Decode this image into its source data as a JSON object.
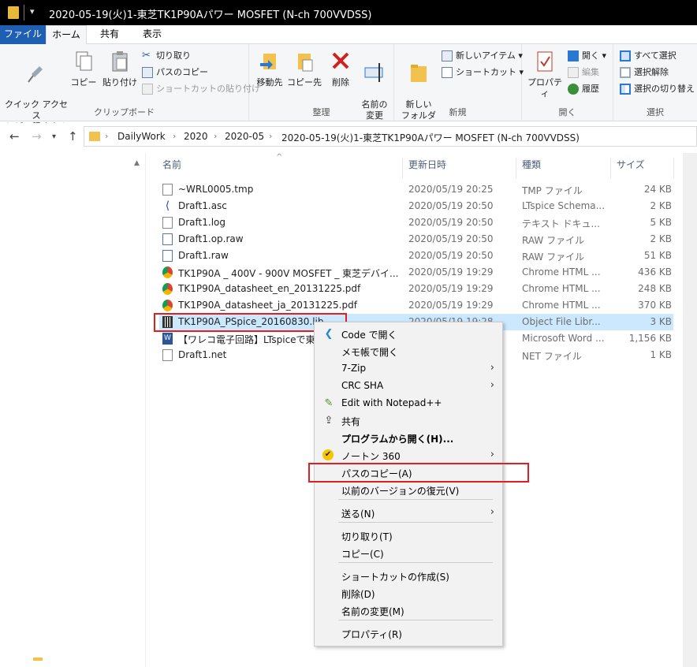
{
  "window": {
    "title": "2020-05-19(火)1-東芝TK1P90Aパワー MOSFET (N-ch 700VVDSS)"
  },
  "ribbon_tabs": [
    "ファイル",
    "ホーム",
    "共有",
    "表示"
  ],
  "ribbon": {
    "clipboard": {
      "label": "クリップボード",
      "pin": "クイック アクセス\nにピン留めする",
      "copy": "コピー",
      "paste": "貼り付け",
      "cut": "切り取り",
      "copy_path": "パスのコピー",
      "paste_shortcut": "ショートカットの貼り付け"
    },
    "organize": {
      "label": "整理",
      "move_to": "移動先",
      "copy_to": "コピー先",
      "delete": "削除",
      "rename": "名前の\n変更"
    },
    "new": {
      "label": "新規",
      "new_folder": "新しい\nフォルダー",
      "new_item": "新しいアイテム",
      "shortcut": "ショートカット"
    },
    "open": {
      "label": "開く",
      "properties": "プロパティ",
      "open": "開く",
      "edit": "編集",
      "history": "履歴"
    },
    "select": {
      "label": "選択",
      "select_all": "すべて選択",
      "select_none": "選択解除",
      "invert": "選択の切り替え"
    }
  },
  "breadcrumb": [
    "DailyWork",
    "2020",
    "2020-05",
    "2020-05-19(火)1-東芝TK1P90Aパワー MOSFET (N-ch 700VVDSS)"
  ],
  "columns": {
    "name": "名前",
    "date": "更新日時",
    "type": "種類",
    "size": "サイズ"
  },
  "files": [
    {
      "name": "~WRL0005.tmp",
      "date": "2020/05/19 20:25",
      "type": "TMP ファイル",
      "size": "24 KB",
      "icon": "blank-file-icon"
    },
    {
      "name": "Draft1.asc",
      "date": "2020/05/19 20:50",
      "type": "LTspice Schema...",
      "size": "2 KB",
      "icon": "ltspice-icon"
    },
    {
      "name": "Draft1.log",
      "date": "2020/05/19 20:50",
      "type": "テキスト ドキュ...",
      "size": "5 KB",
      "icon": "text-file-icon"
    },
    {
      "name": "Draft1.op.raw",
      "date": "2020/05/19 20:50",
      "type": "RAW ファイル",
      "size": "2 KB",
      "icon": "raw-file-icon"
    },
    {
      "name": "Draft1.raw",
      "date": "2020/05/19 20:50",
      "type": "RAW ファイル",
      "size": "51 KB",
      "icon": "raw-file-icon"
    },
    {
      "name": "TK1P90A _ 400V - 900V MOSFET _ 東芝デバイ...",
      "date": "2020/05/19 19:29",
      "type": "Chrome HTML ...",
      "size": "436 KB",
      "icon": "chrome-icon"
    },
    {
      "name": "TK1P90A_datasheet_en_20131225.pdf",
      "date": "2020/05/19 19:29",
      "type": "Chrome HTML ...",
      "size": "248 KB",
      "icon": "chrome-icon"
    },
    {
      "name": "TK1P90A_datasheet_ja_20131225.pdf",
      "date": "2020/05/19 19:29",
      "type": "Chrome HTML ...",
      "size": "370 KB",
      "icon": "chrome-icon"
    },
    {
      "name": "TK1P90A_PSpice_20160830.lib",
      "date": "2020/05/19 19:28",
      "type": "Object File Libr...",
      "size": "3 KB",
      "icon": "lib-file-icon"
    },
    {
      "name": "【ワレコ電子回路】LTspiceで東",
      "date": "",
      "type": "Microsoft Word ...",
      "size": "1,156 KB",
      "icon": "word-icon"
    },
    {
      "name": "Draft1.net",
      "date": "",
      "type": "NET ファイル",
      "size": "1 KB",
      "icon": "blank-file-icon"
    }
  ],
  "context_menu": [
    {
      "label": "Code で開く",
      "icon": "vscode-icon"
    },
    {
      "label": "メモ帳で開く"
    },
    {
      "label": "7-Zip",
      "submenu": true
    },
    {
      "label": "CRC SHA",
      "submenu": true
    },
    {
      "label": "Edit with Notepad++",
      "icon": "notepadpp-icon"
    },
    {
      "label": "共有",
      "icon": "share-icon"
    },
    {
      "label": "プログラムから開く(H)..."
    },
    {
      "label": "ノートン 360",
      "icon": "norton-icon",
      "submenu": true
    },
    {
      "label": "パスのコピー(A)"
    },
    {
      "label": "以前のバージョンの復元(V)"
    },
    {
      "label": "送る(N)",
      "submenu": true
    },
    {
      "label": "切り取り(T)"
    },
    {
      "label": "コピー(C)"
    },
    {
      "label": "ショートカットの作成(S)"
    },
    {
      "label": "削除(D)"
    },
    {
      "label": "名前の変更(M)"
    },
    {
      "label": "プロパティ(R)"
    }
  ],
  "colors": {
    "file_tab": "#1e5fb4",
    "selection": "#cce8ff",
    "highlight_box": "#e02020"
  }
}
